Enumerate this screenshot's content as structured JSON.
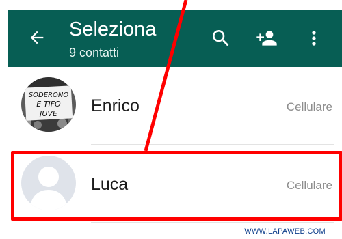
{
  "header": {
    "title": "Seleziona",
    "subtitle": "9 contatti",
    "icons": [
      "back-arrow-icon",
      "search-icon",
      "add-contact-icon",
      "more-vert-icon"
    ],
    "background_color": "#075e54"
  },
  "contacts": [
    {
      "name": "Enrico",
      "type": "Cellulare",
      "avatar_text": [
        "SODERONO",
        "E TIFO",
        "JUVE"
      ]
    },
    {
      "name": "Luca",
      "type": "Cellulare",
      "avatar": "default-avatar-icon"
    }
  ],
  "annotation": {
    "highlight_color": "#ff0000"
  },
  "watermark": "WWW.LAPAWEB.COM"
}
